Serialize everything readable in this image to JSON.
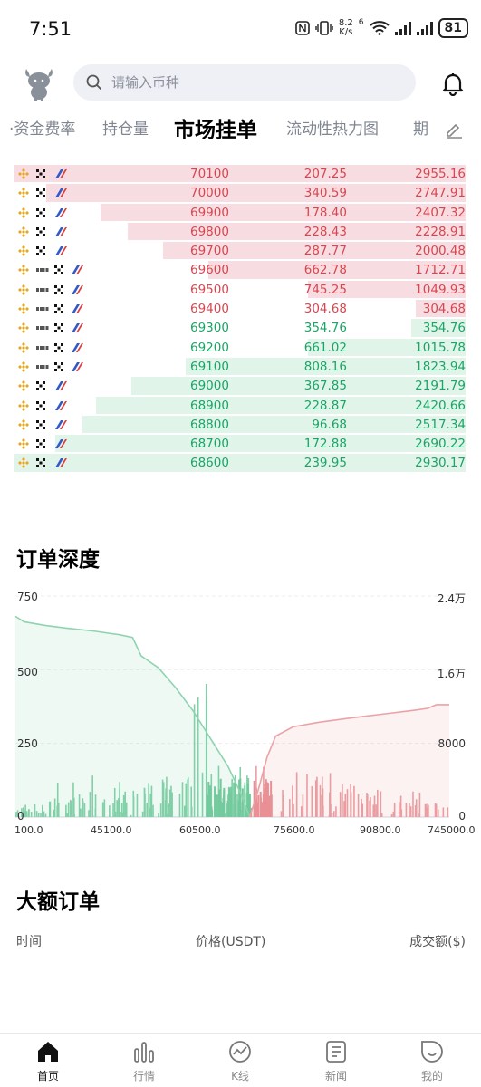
{
  "status_bar": {
    "time": "7:51",
    "net_speed_value": "8.2",
    "net_speed_unit": "K/s",
    "signal_label": "6",
    "battery": "81"
  },
  "header": {
    "search_placeholder": "请输入币种"
  },
  "tabs": [
    {
      "label": "·资金费率"
    },
    {
      "label": "持仓量"
    },
    {
      "label": "市场挂单",
      "active": true
    },
    {
      "label": "流动性热力图"
    },
    {
      "label": "期"
    }
  ],
  "orderbook": {
    "asks": [
      {
        "price": "70100",
        "amount": "207.25",
        "total": "2955.16",
        "fill": 1.0,
        "ex": [
          "bn",
          "ok",
          "cb"
        ]
      },
      {
        "price": "70000",
        "amount": "340.59",
        "total": "2747.91",
        "fill": 0.93,
        "ex": [
          "bn",
          "ok",
          "cb"
        ]
      },
      {
        "price": "69900",
        "amount": "178.40",
        "total": "2407.32",
        "fill": 0.81,
        "ex": [
          "bn",
          "ok",
          "cb"
        ]
      },
      {
        "price": "69800",
        "amount": "228.43",
        "total": "2228.91",
        "fill": 0.75,
        "ex": [
          "bn",
          "ok",
          "cb"
        ]
      },
      {
        "price": "69700",
        "amount": "287.77",
        "total": "2000.48",
        "fill": 0.67,
        "ex": [
          "bn",
          "ok",
          "cb"
        ]
      },
      {
        "price": "69600",
        "amount": "662.78",
        "total": "1712.71",
        "fill": 0.57,
        "ex": [
          "bn",
          "by",
          "ok",
          "cb"
        ]
      },
      {
        "price": "69500",
        "amount": "745.25",
        "total": "1049.93",
        "fill": 0.35,
        "ex": [
          "bn",
          "by",
          "ok",
          "cb"
        ]
      },
      {
        "price": "69400",
        "amount": "304.68",
        "total": "304.68",
        "fill": 0.11,
        "ex": [
          "bn",
          "by",
          "ok",
          "cb"
        ]
      }
    ],
    "bids": [
      {
        "price": "69300",
        "amount": "354.76",
        "total": "354.76",
        "fill": 0.12,
        "ex": [
          "bn",
          "by",
          "ok",
          "cb"
        ]
      },
      {
        "price": "69200",
        "amount": "661.02",
        "total": "1015.78",
        "fill": 0.35,
        "ex": [
          "bn",
          "by",
          "ok",
          "cb"
        ]
      },
      {
        "price": "69100",
        "amount": "808.16",
        "total": "1823.94",
        "fill": 0.62,
        "ex": [
          "bn",
          "by",
          "ok",
          "cb"
        ]
      },
      {
        "price": "69000",
        "amount": "367.85",
        "total": "2191.79",
        "fill": 0.74,
        "ex": [
          "bn",
          "ok",
          "cb"
        ]
      },
      {
        "price": "68900",
        "amount": "228.87",
        "total": "2420.66",
        "fill": 0.82,
        "ex": [
          "bn",
          "ok",
          "cb"
        ]
      },
      {
        "price": "68800",
        "amount": "96.68",
        "total": "2517.34",
        "fill": 0.85,
        "ex": [
          "bn",
          "ok",
          "cb"
        ]
      },
      {
        "price": "68700",
        "amount": "172.88",
        "total": "2690.22",
        "fill": 0.91,
        "ex": [
          "bn",
          "ok",
          "cb"
        ]
      },
      {
        "price": "68600",
        "amount": "239.95",
        "total": "2930.17",
        "fill": 1.0,
        "ex": [
          "bn",
          "ok",
          "cb"
        ]
      }
    ]
  },
  "depth_section": {
    "title": "订单深度"
  },
  "chart_data": {
    "type": "area",
    "y_left_ticks": [
      "750",
      "500",
      "250",
      "0"
    ],
    "y_right_ticks": [
      "2.4万",
      "1.6万",
      "8000",
      "0"
    ],
    "x_ticks": [
      "100.0",
      "45100.0",
      "60500.0",
      "75600.0",
      "90800.0",
      "745000.0"
    ],
    "grid": true,
    "series": [
      {
        "side": "bid",
        "color": "#8fd3b0",
        "cumulative": [
          [
            0,
            21800
          ],
          [
            0.02,
            21200
          ],
          [
            0.07,
            20800
          ],
          [
            0.12,
            20500
          ],
          [
            0.18,
            20200
          ],
          [
            0.24,
            19800
          ],
          [
            0.27,
            19500
          ],
          [
            0.29,
            17500
          ],
          [
            0.33,
            16200
          ],
          [
            0.37,
            14000
          ],
          [
            0.41,
            11500
          ],
          [
            0.45,
            8500
          ],
          [
            0.49,
            5500
          ],
          [
            0.52,
            2500
          ],
          [
            0.54,
            0
          ]
        ]
      },
      {
        "side": "ask",
        "color": "#eba2a6",
        "cumulative": [
          [
            0.54,
            0
          ],
          [
            0.56,
            3000
          ],
          [
            0.58,
            6500
          ],
          [
            0.6,
            8800
          ],
          [
            0.64,
            9800
          ],
          [
            0.7,
            10300
          ],
          [
            0.78,
            10800
          ],
          [
            0.85,
            11200
          ],
          [
            0.92,
            11600
          ],
          [
            0.95,
            11800
          ],
          [
            0.97,
            12200
          ],
          [
            1.0,
            12200
          ]
        ]
      }
    ]
  },
  "large_orders": {
    "title": "大额订单",
    "col_time": "时间",
    "col_price": "价格(USDT)",
    "col_value": "成交额($)"
  },
  "nav": [
    {
      "label": "首页",
      "active": true
    },
    {
      "label": "行情"
    },
    {
      "label": "K线"
    },
    {
      "label": "新闻"
    },
    {
      "label": "我的"
    }
  ]
}
